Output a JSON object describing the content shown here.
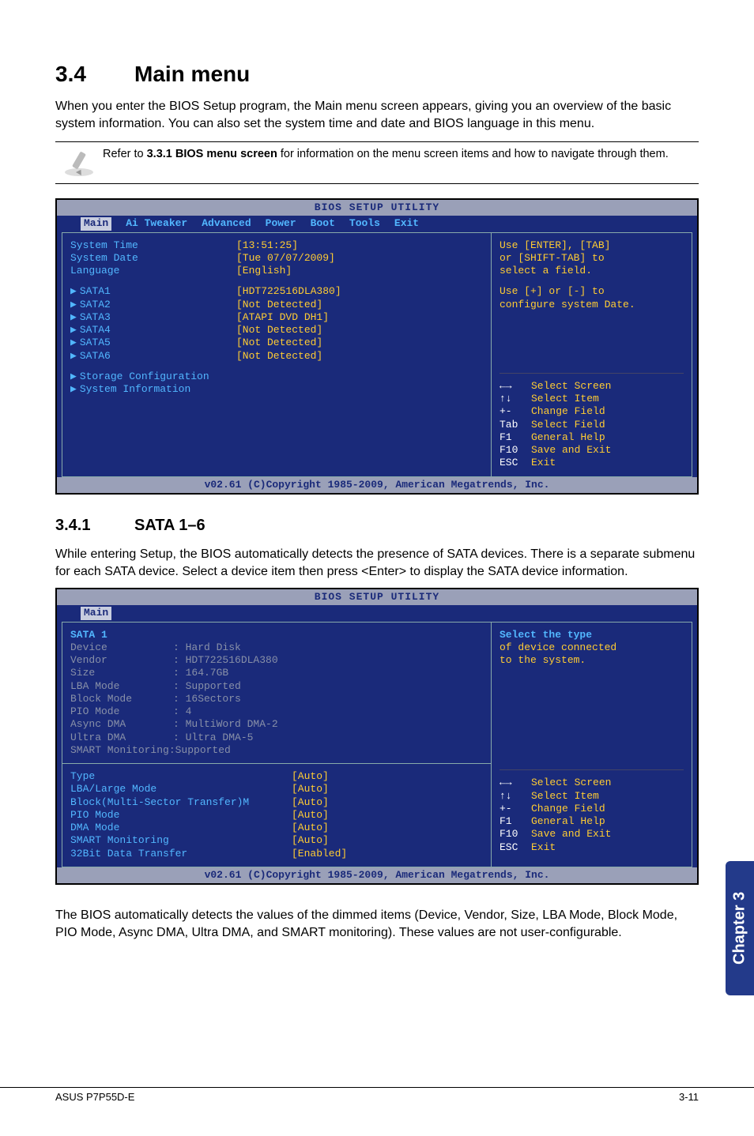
{
  "section": {
    "num": "3.4",
    "title": "Main menu"
  },
  "intro": "When you enter the BIOS Setup program, the Main menu screen appears, giving you an overview of the basic system information. You can also set the system time and date and BIOS language in this menu.",
  "note": {
    "prefix": "Refer to ",
    "bold": "3.3.1 BIOS menu screen",
    "suffix": " for information on the menu screen items and how to navigate through them."
  },
  "bios1": {
    "title": "BIOS SETUP UTILITY",
    "tabs": [
      "Main",
      "Ai Tweaker",
      "Advanced",
      "Power",
      "Boot",
      "Tools",
      "Exit"
    ],
    "selected_tab": "Main",
    "fields": [
      {
        "label": "System Time",
        "value": "[13:51:25]"
      },
      {
        "label": "System Date",
        "value": "[Tue 07/07/2009]"
      },
      {
        "label": "Language",
        "value": "[English]"
      }
    ],
    "sata": [
      {
        "label": "SATA1",
        "value": "[HDT722516DLA380]"
      },
      {
        "label": "SATA2",
        "value": "[Not Detected]"
      },
      {
        "label": "SATA3",
        "value": "[ATAPI DVD DH1]"
      },
      {
        "label": "SATA4",
        "value": "[Not Detected]"
      },
      {
        "label": "SATA5",
        "value": "[Not Detected]"
      },
      {
        "label": "SATA6",
        "value": "[Not Detected]"
      }
    ],
    "submenus": [
      "Storage Configuration",
      "System Information"
    ],
    "help_top": [
      "Use [ENTER], [TAB]",
      "or [SHIFT-TAB] to",
      "select a field."
    ],
    "help_mid": [
      "Use [+] or [-] to",
      "configure system Date."
    ],
    "help_keys": [
      {
        "k": "←→",
        "d": "Select Screen"
      },
      {
        "k": "↑↓",
        "d": "Select Item"
      },
      {
        "k": "+-",
        "d": "Change Field"
      },
      {
        "k": "Tab",
        "d": "Select Field"
      },
      {
        "k": "F1",
        "d": "General Help"
      },
      {
        "k": "F10",
        "d": "Save and Exit"
      },
      {
        "k": "ESC",
        "d": "Exit"
      }
    ],
    "footer": "v02.61 (C)Copyright 1985-2009, American Megatrends, Inc."
  },
  "subsection": {
    "num": "3.4.1",
    "title": "SATA 1–6"
  },
  "sub_intro": "While entering Setup, the BIOS automatically detects the presence of SATA devices. There is a separate submenu for each SATA device. Select a device item then press <Enter> to display the SATA device information.",
  "bios2": {
    "title": "BIOS SETUP UTILITY",
    "tab": "Main",
    "heading": "SATA 1",
    "info": [
      {
        "label": "Device",
        "value": ": Hard Disk"
      },
      {
        "label": "Vendor",
        "value": ": HDT722516DLA380"
      },
      {
        "label": "Size",
        "value": ": 164.7GB"
      },
      {
        "label": "LBA Mode",
        "value": ": Supported"
      },
      {
        "label": "Block Mode",
        "value": ": 16Sectors"
      },
      {
        "label": "PIO Mode",
        "value": ": 4"
      },
      {
        "label": "Async DMA",
        "value": ": MultiWord DMA-2"
      },
      {
        "label": "Ultra DMA",
        "value": ": Ultra DMA-5"
      },
      {
        "label": "SMART Monitoring",
        "value": ":Supported",
        "nosplit": true
      }
    ],
    "settings": [
      {
        "label": "Type",
        "value": "[Auto]"
      },
      {
        "label": "LBA/Large Mode",
        "value": "[Auto]"
      },
      {
        "label": "Block(Multi-Sector Transfer)M",
        "value": "[Auto]"
      },
      {
        "label": "PIO Mode",
        "value": "[Auto]"
      },
      {
        "label": "DMA Mode",
        "value": "[Auto]"
      },
      {
        "label": "SMART Monitoring",
        "value": "[Auto]"
      },
      {
        "label": "32Bit Data Transfer",
        "value": "[Enabled]"
      }
    ],
    "help_top": [
      "Select the type",
      "of device connected",
      "to the system."
    ],
    "help_keys": [
      {
        "k": "←→",
        "d": "Select Screen"
      },
      {
        "k": "↑↓",
        "d": "Select Item"
      },
      {
        "k": "+-",
        "d": "Change Field"
      },
      {
        "k": "F1",
        "d": "General Help"
      },
      {
        "k": "F10",
        "d": "Save and Exit"
      },
      {
        "k": "ESC",
        "d": "Exit"
      }
    ],
    "footer": "v02.61 (C)Copyright 1985-2009, American Megatrends, Inc."
  },
  "outro": "The BIOS automatically detects the values of the dimmed items (Device, Vendor, Size, LBA Mode, Block Mode, PIO Mode, Async DMA, Ultra DMA, and SMART monitoring). These values are not user-configurable.",
  "side_tab": "Chapter 3",
  "footer_left": "ASUS P7P55D-E",
  "footer_right": "3-11"
}
